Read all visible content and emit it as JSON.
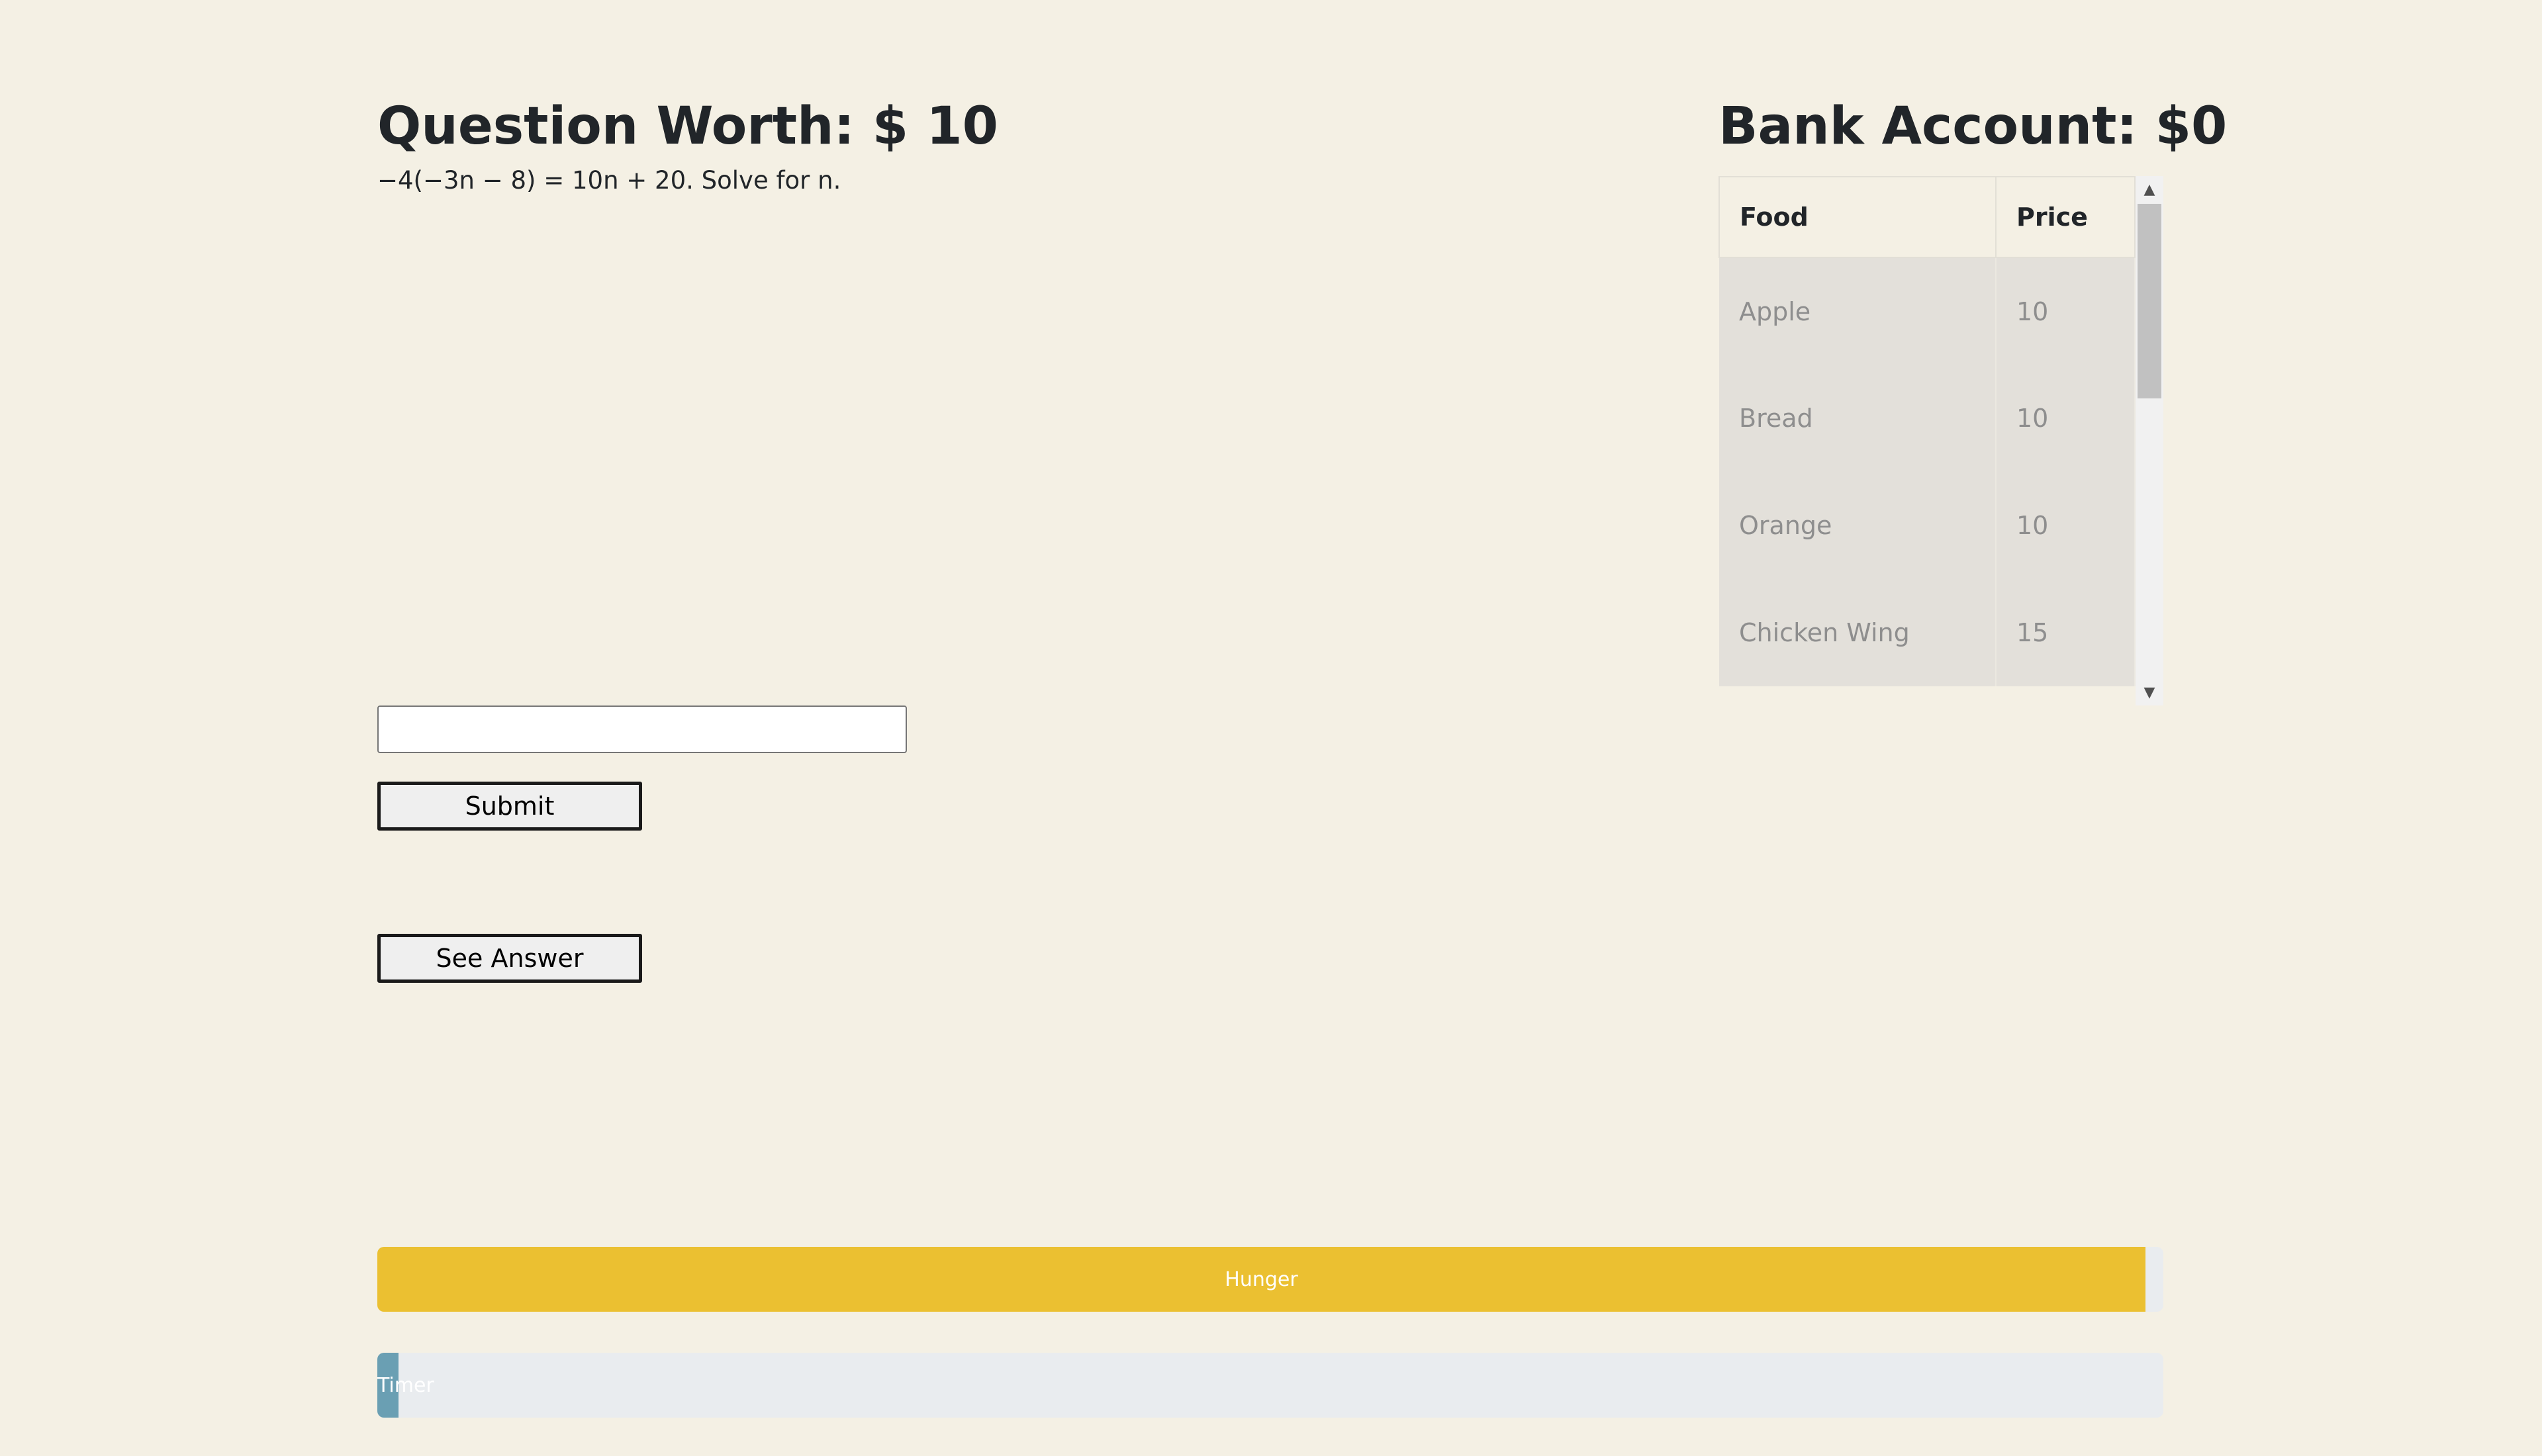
{
  "question": {
    "title": "Question Worth: $ 10",
    "text": "−4(−3n − 8) = 10n + 20. Solve for n."
  },
  "answer": {
    "value": "",
    "placeholder": ""
  },
  "buttons": {
    "submit_label": "Submit",
    "see_answer_label": "See Answer"
  },
  "bank": {
    "title": "Bank Account: $0"
  },
  "food_table": {
    "headers": [
      "Food",
      "Price"
    ],
    "rows": [
      {
        "food": "Apple",
        "price": "10"
      },
      {
        "food": "Bread",
        "price": "10"
      },
      {
        "food": "Orange",
        "price": "10"
      },
      {
        "food": "Chicken Wing",
        "price": "15"
      }
    ]
  },
  "bars": {
    "hunger": {
      "label": "Hunger",
      "percent": 99
    },
    "timer": {
      "label": "Timer",
      "percent": 1.2
    }
  },
  "colors": {
    "background": "#f4f0e4",
    "hunger_bar": "#ebc031",
    "timer_bar": "#6a9fb3",
    "bar_track": "#e9ecef"
  },
  "icons": {
    "scroll_up": "triangle-up-icon",
    "scroll_down": "triangle-down-icon"
  }
}
